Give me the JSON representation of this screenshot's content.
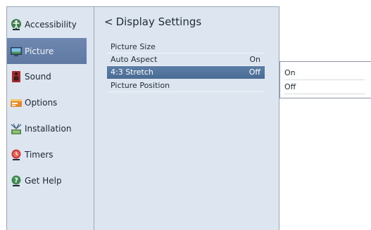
{
  "sidebar": {
    "items": [
      {
        "label": "Accessibility",
        "icon": "accessibility-icon"
      },
      {
        "label": "Picture",
        "icon": "picture-icon"
      },
      {
        "label": "Sound",
        "icon": "speaker-icon"
      },
      {
        "label": "Options",
        "icon": "options-icon"
      },
      {
        "label": "Installation",
        "icon": "antenna-icon"
      },
      {
        "label": "Timers",
        "icon": "timer-icon"
      },
      {
        "label": "Get Help",
        "icon": "help-icon"
      }
    ]
  },
  "main": {
    "back_glyph": "<",
    "title": "Display Settings",
    "rows": [
      {
        "label": "Picture Size",
        "value": ""
      },
      {
        "label": "Auto Aspect",
        "value": "On"
      },
      {
        "label": "4:3 Stretch",
        "value": "Off"
      },
      {
        "label": "Picture Position",
        "value": ""
      }
    ]
  },
  "popup": {
    "options": [
      {
        "label": "On"
      },
      {
        "label": "Off"
      }
    ]
  },
  "colors": {
    "panel_bg": "#dde6f0",
    "selection": "#5d7fa7"
  }
}
